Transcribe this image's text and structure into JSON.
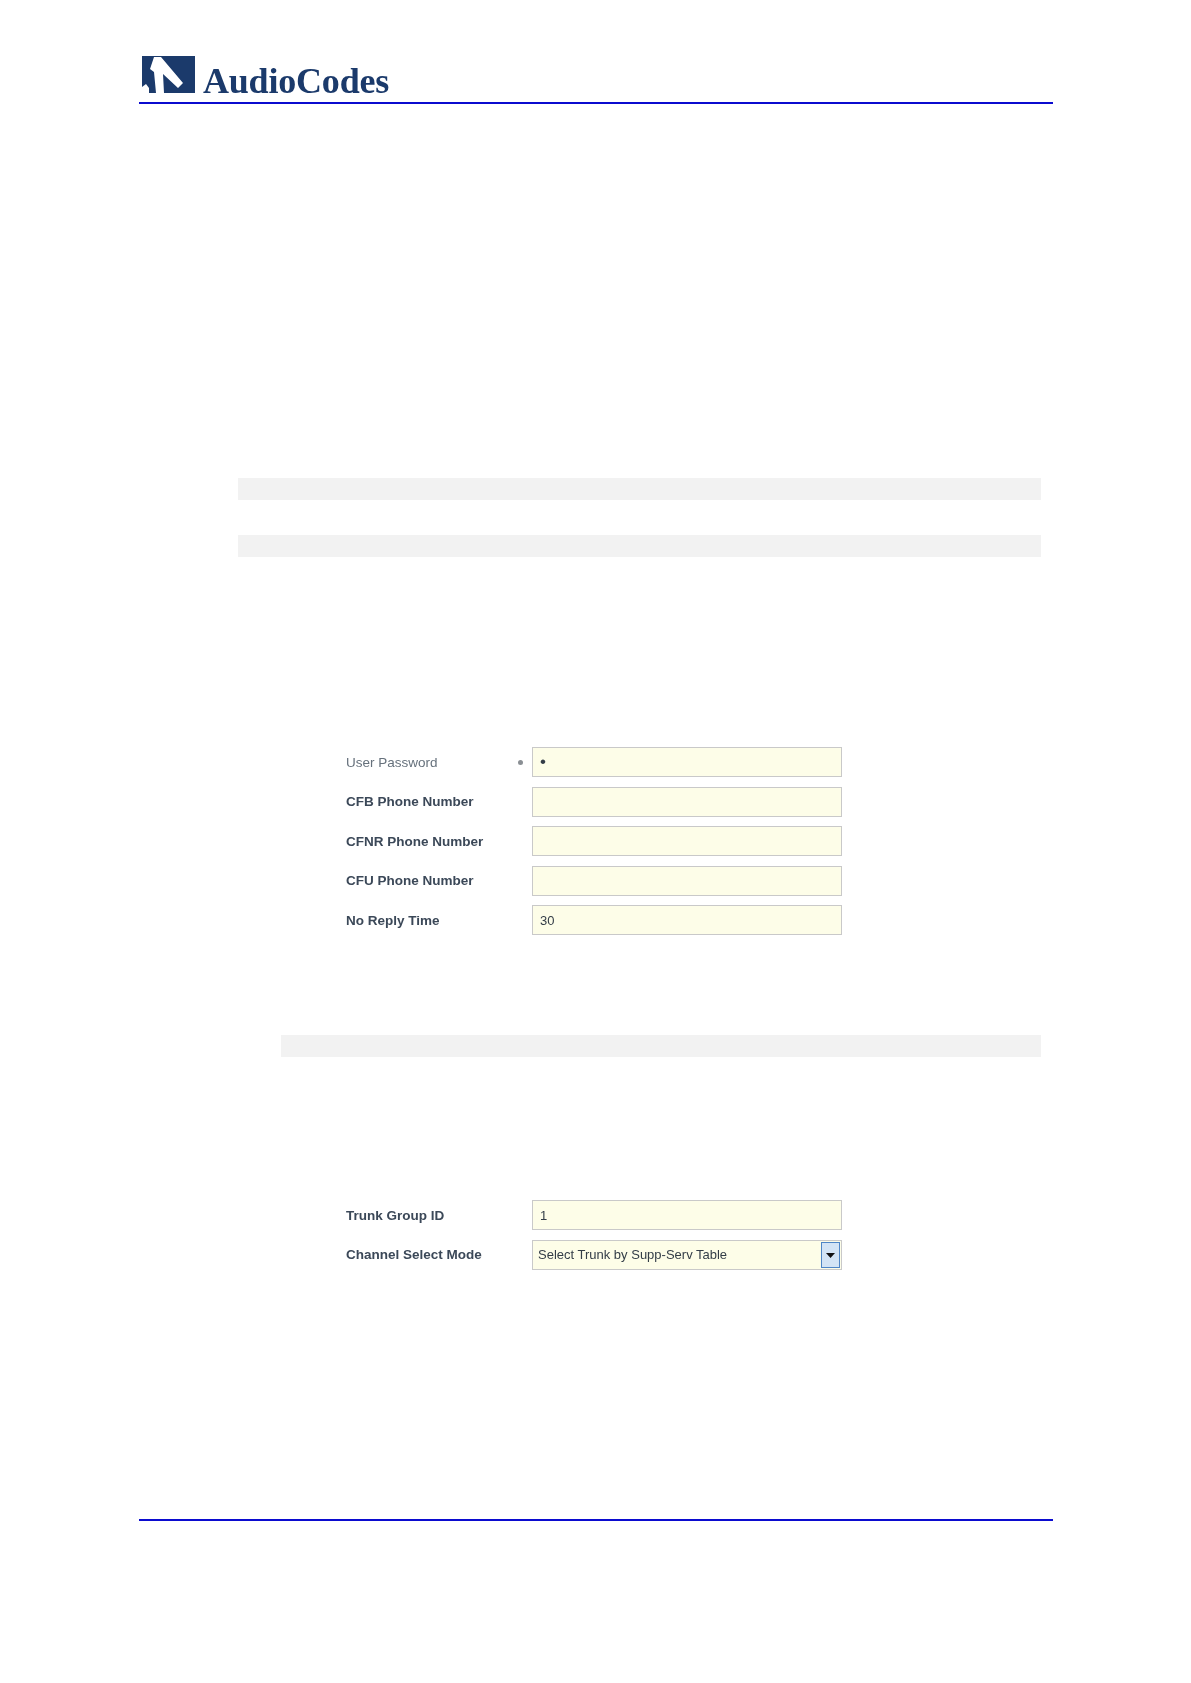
{
  "header": {
    "logo_text": "AudioCodes"
  },
  "content": [
    {
      "kind": "shaded_bar",
      "indented": false
    },
    {
      "kind": "shaded_bar",
      "indented": false
    },
    {
      "kind": "form",
      "fields": [
        {
          "label": "User Password",
          "bold": false,
          "modified": true,
          "kind": "password",
          "value": "•"
        },
        {
          "label": "CFB Phone Number",
          "bold": true,
          "modified": false,
          "kind": "text"
        },
        {
          "label": "CFNR Phone Number",
          "bold": true,
          "modified": false,
          "kind": "text"
        },
        {
          "label": "CFU Phone Number",
          "bold": true,
          "modified": false,
          "kind": "text"
        },
        {
          "label": "No Reply Time",
          "bold": true,
          "modified": false,
          "kind": "text",
          "value": "30"
        }
      ]
    },
    {
      "kind": "shaded_bar",
      "indented": true
    },
    {
      "kind": "form",
      "fields": [
        {
          "label": "Trunk Group ID",
          "bold": true,
          "modified": false,
          "kind": "text",
          "value": "1"
        },
        {
          "label": "Channel Select Mode",
          "bold": true,
          "modified": false,
          "kind": "select",
          "value": "Select Trunk by Supp-Serv Table"
        }
      ]
    }
  ]
}
